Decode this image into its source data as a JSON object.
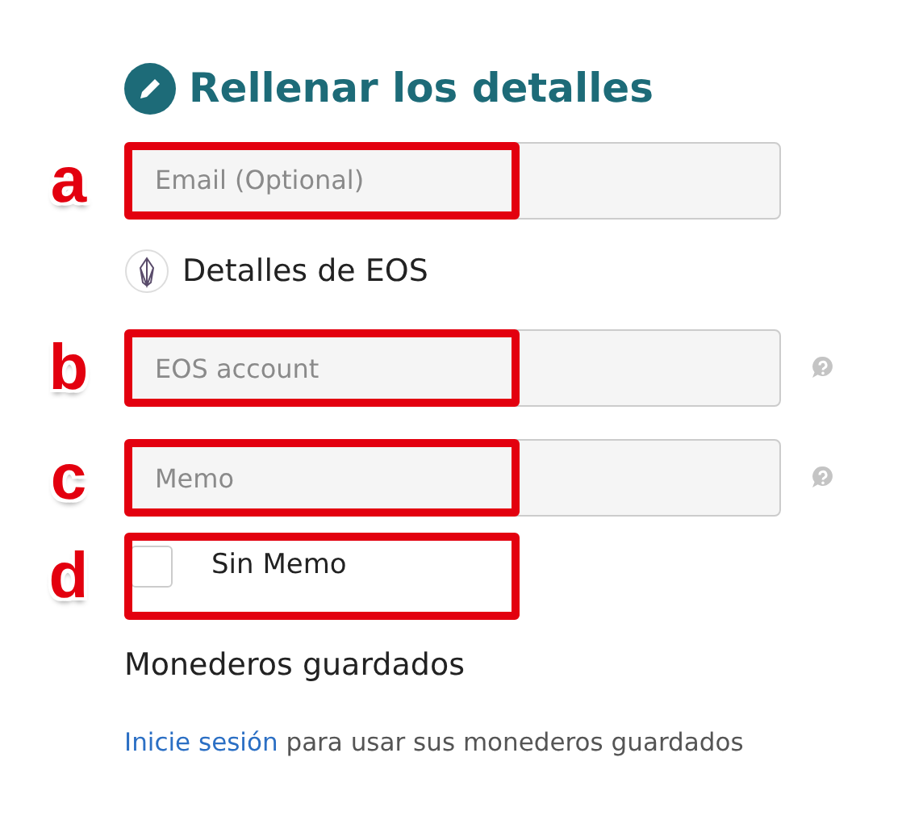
{
  "heading": "Rellenar los detalles",
  "email_field": {
    "placeholder": "Email (Optional)",
    "callout": "a"
  },
  "section": "Detalles de EOS",
  "fields": [
    {
      "placeholder": "EOS account",
      "callout": "b"
    },
    {
      "placeholder": "Memo",
      "callout": "c"
    }
  ],
  "no_memo": {
    "label": "Sin Memo",
    "checked": false,
    "callout": "d"
  },
  "saved_wallets": {
    "title": "Monederos guardados",
    "link": "Inicie sesión",
    "text": "para usar sus monederos guardados"
  }
}
